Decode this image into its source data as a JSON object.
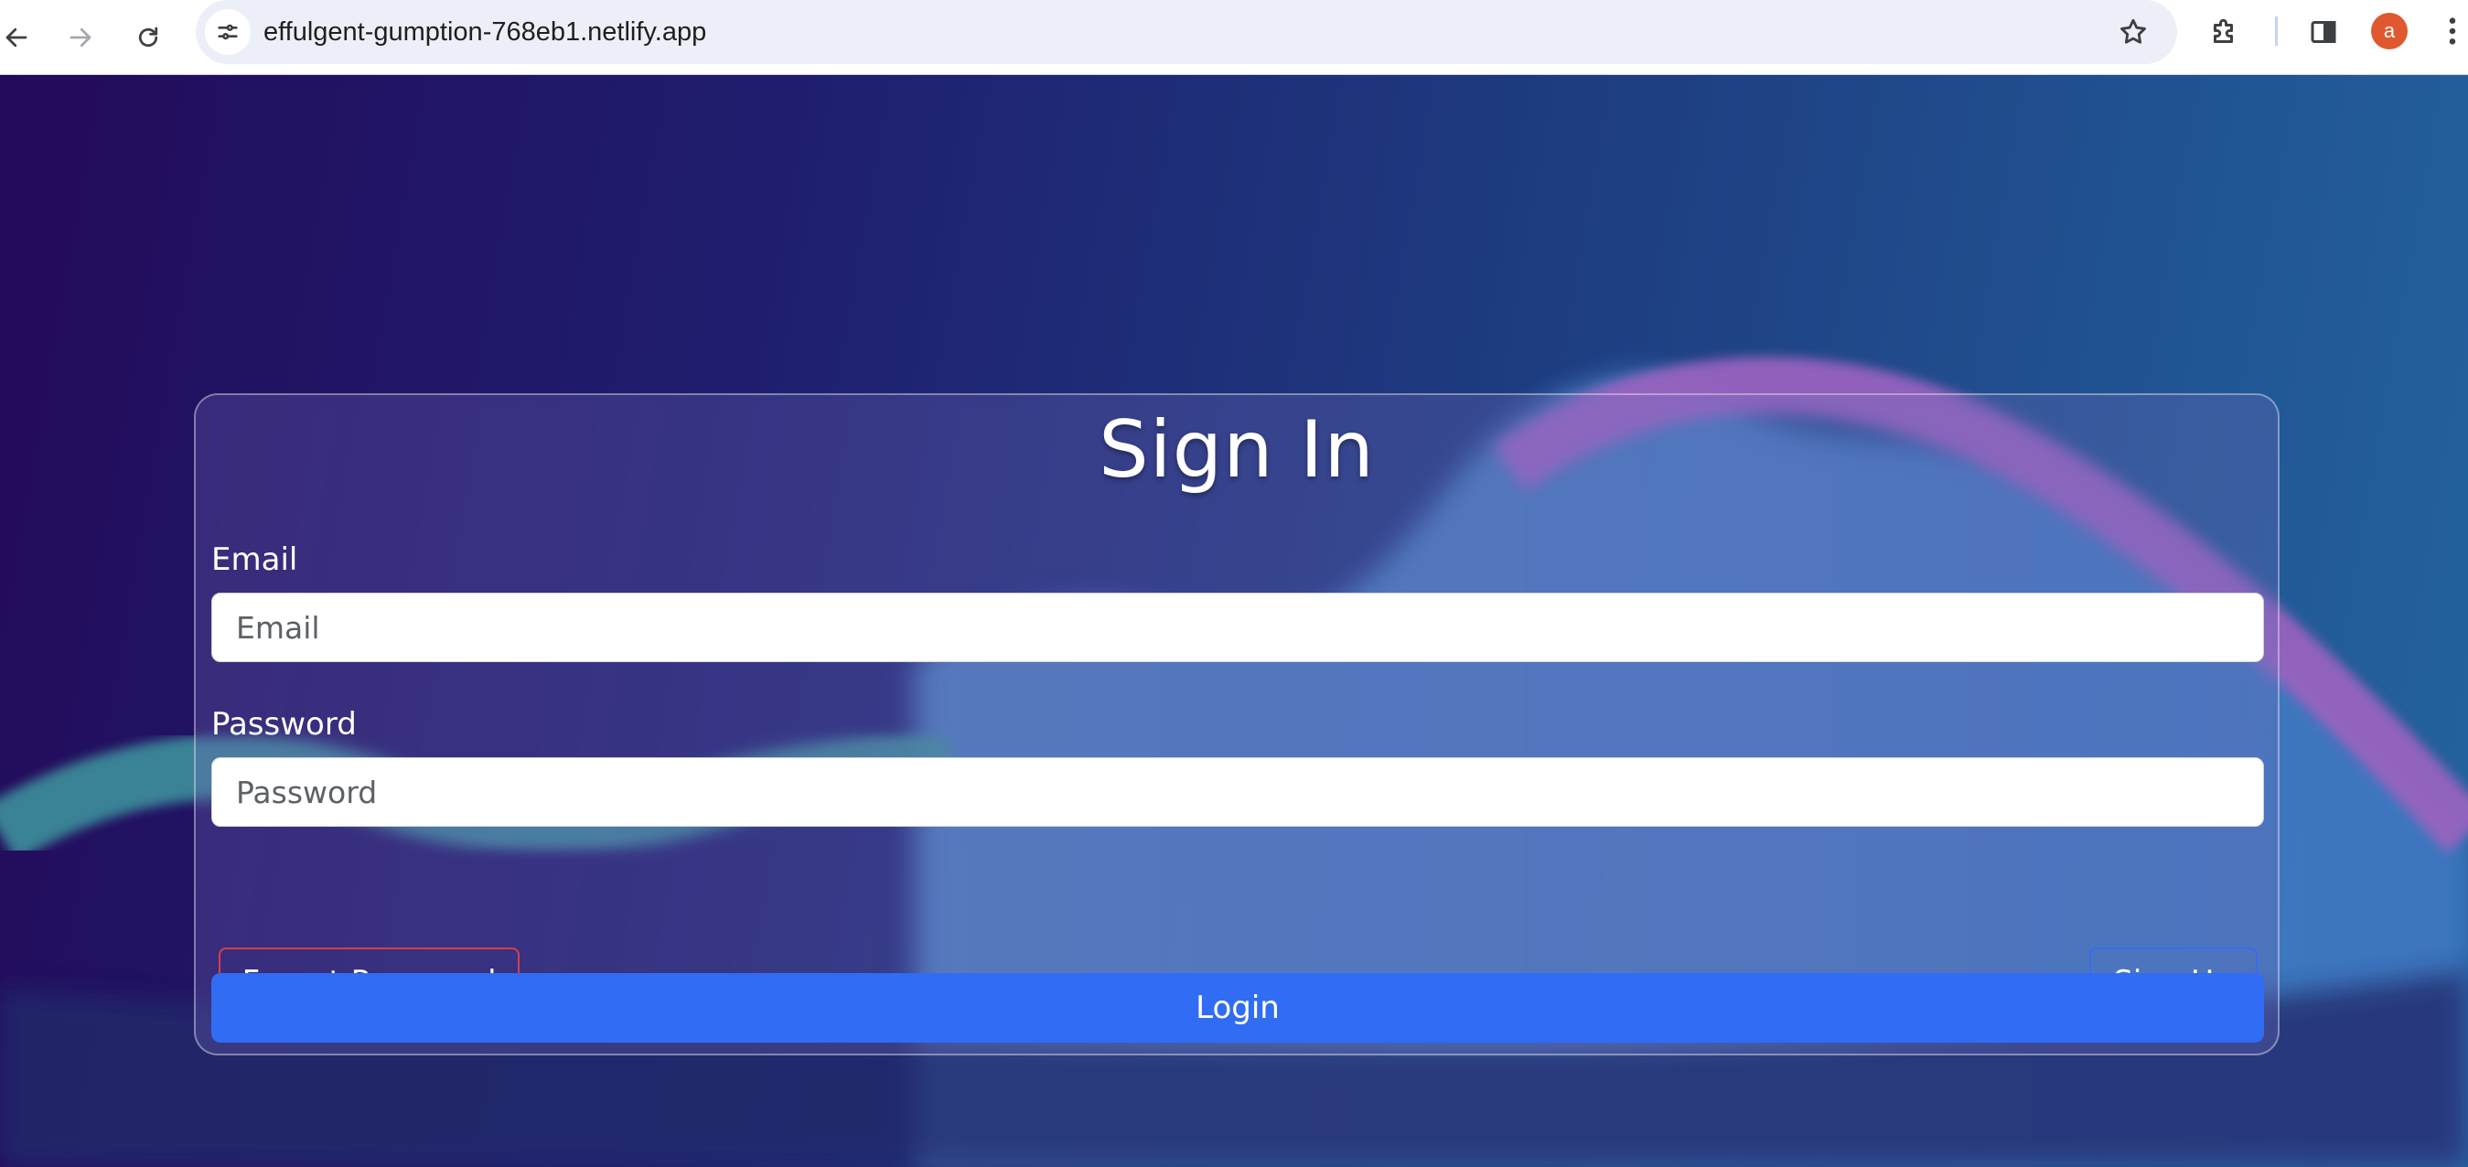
{
  "browser": {
    "url": "effulgent-gumption-768eb1.netlify.app",
    "profile_initial": "a",
    "icons": {
      "back": "back-arrow-icon",
      "forward": "forward-arrow-icon",
      "reload": "reload-icon",
      "site_info": "tune-icon",
      "bookmark": "star-icon",
      "extensions": "puzzle-icon",
      "side_panel": "side-panel-icon",
      "menu": "more-vert-icon"
    },
    "colors": {
      "avatar": "#e0582f"
    }
  },
  "signin": {
    "title": "Sign In",
    "email_label": "Email",
    "email_placeholder": "Email",
    "password_label": "Password",
    "password_placeholder": "Password",
    "forgot_label": "Forgot Password",
    "signup_label": "Sign Up",
    "login_label": "Login",
    "colors": {
      "login_button": "#316cf4",
      "forgot_border": "#d2404a",
      "signup_border": "#3a6cf0"
    }
  }
}
